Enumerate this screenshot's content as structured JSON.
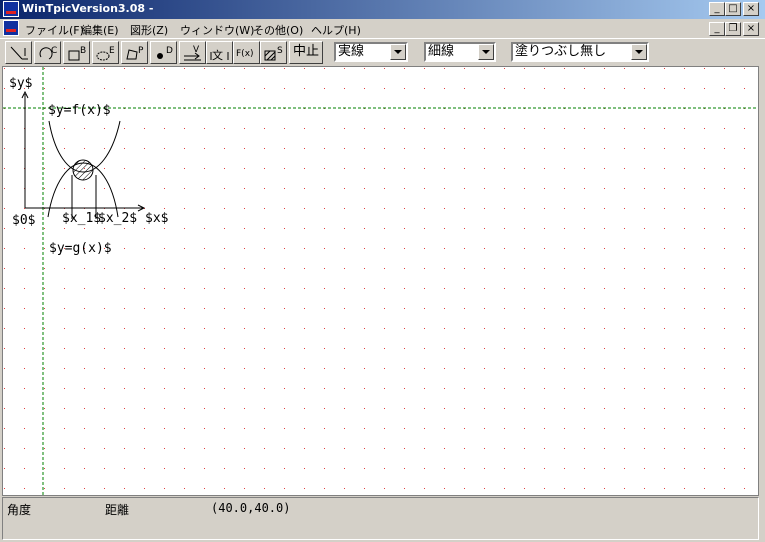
{
  "window": {
    "title": "WinTpicVersion3.08 -",
    "minimize": "_",
    "maximize": "□",
    "close": "×",
    "mdi_minimize": "_",
    "mdi_restore": "❐",
    "mdi_close": "×"
  },
  "menu": {
    "items": [
      {
        "label": "ファイル(F)"
      },
      {
        "label": "編集(E)"
      },
      {
        "label": "図形(Z)"
      },
      {
        "label": "ウィンドウ(W)"
      },
      {
        "label": "その他(O)"
      },
      {
        "label": "ヘルプ(H)"
      }
    ]
  },
  "toolbar": {
    "tools": [
      {
        "icon": "line-tool-icon",
        "letter": ""
      },
      {
        "icon": "circle-tool-icon",
        "letter": "C"
      },
      {
        "icon": "box-tool-icon",
        "letter": "B"
      },
      {
        "icon": "ellipse-tool-icon",
        "letter": "E"
      },
      {
        "icon": "polygon-tool-icon",
        "letter": "P"
      },
      {
        "icon": "dot-tool-icon",
        "letter": "D"
      },
      {
        "icon": "vector-tool-icon",
        "letter": "V"
      },
      {
        "icon": "text-tool-icon",
        "letter": "文"
      },
      {
        "icon": "function-tool-icon",
        "letter": "F(x)"
      },
      {
        "icon": "shade-tool-icon",
        "letter": "S"
      }
    ],
    "stop_label": "中止",
    "line_style": "実線",
    "line_width": "細線",
    "fill_mode": "塗りつぶし無し"
  },
  "canvas": {
    "labels": {
      "y_axis": "$y$",
      "origin": "$0$",
      "x1": "$x_1$",
      "x2": "$x_2$",
      "x_axis": "$x$",
      "f_label": "$y=f(x)$",
      "g_label": "$y=g(x)$"
    },
    "grid_dot_color": "#e04040",
    "guide_color": "#008000"
  },
  "status": {
    "angle_label": "角度",
    "distance_label": "距離",
    "coords": "(40.0,40.0)"
  }
}
